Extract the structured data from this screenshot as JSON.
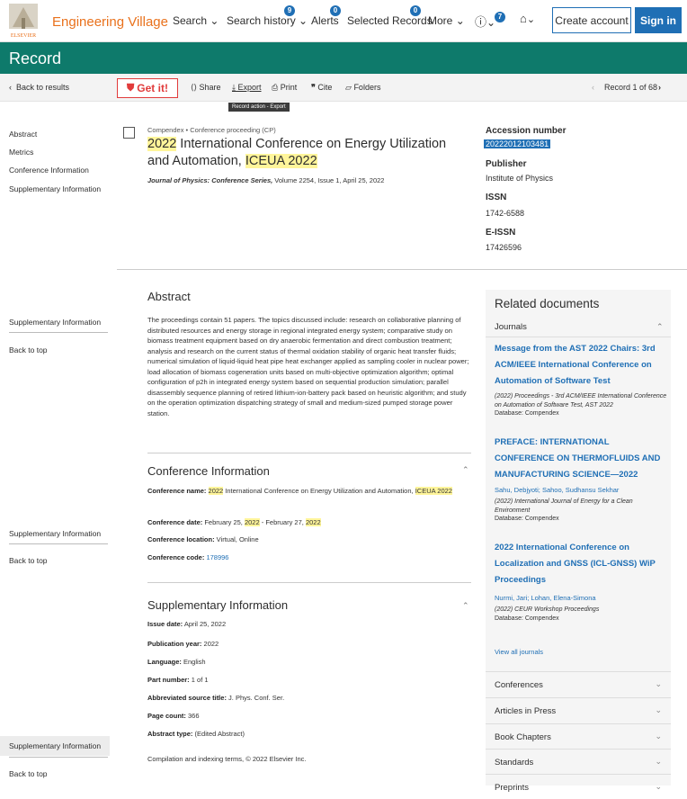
{
  "header": {
    "brand": "Engineering Village",
    "nav": [
      {
        "label": "Search",
        "chevron": true
      },
      {
        "label": "Search history",
        "chevron": true,
        "badge": "9"
      },
      {
        "label": "Alerts",
        "badge": "0"
      },
      {
        "label": "Selected Records",
        "badge": "0"
      },
      {
        "label": "More",
        "chevron": true
      }
    ],
    "help_badge": "7",
    "create_account": "Create account",
    "sign_in": "Sign in"
  },
  "page_title": "Record",
  "action_bar": {
    "back": "Back to results",
    "getit": "Get it!",
    "share": "Share",
    "export": "Export",
    "print": "Print",
    "cite": "Cite",
    "folders": "Folders",
    "record_nav": "Record 1 of 68",
    "tooltip": "Record action - Export"
  },
  "sidebar": {
    "items": [
      "Abstract",
      "Metrics",
      "Conference Information",
      "Supplementary Information"
    ],
    "sticky_label": "Supplementary Information",
    "back_to_top": "Back to top"
  },
  "record": {
    "meta": "Compendex • Conference proceeding (CP)",
    "title_part1": "2022",
    "title_part2": " International Conference on Energy Utilization and Automation, ",
    "title_part3": "ICEUA 2022",
    "journal_name": "Journal of Physics: Conference Series,",
    "journal_rest": " Volume 2254, Issue 1, April 25, 2022"
  },
  "details": {
    "accession_label": "Accession number",
    "accession_value": "20222012103481",
    "publisher_label": "Publisher",
    "publisher_value": "Institute of Physics",
    "issn_label": "ISSN",
    "issn_value": "1742-6588",
    "eissn_label": "E-ISSN",
    "eissn_value": "17426596"
  },
  "abstract": {
    "heading": "Abstract",
    "text": "The proceedings contain 51 papers. The topics discussed include: research on collaborative planning of distributed resources and energy storage in regional integrated energy system; comparative study on biomass treatment equipment based on dry anaerobic fermentation and direct combustion treatment; analysis and research on the current status of thermal oxidation stability of organic heat transfer fluids; numerical simulation of liquid-liquid heat pipe heat exchanger applied as sampling cooler in nuclear power; load allocation of biomass cogeneration units based on multi-objective optimization algorithm; optimal configuration of p2h in integrated energy system based on sequential production simulation; parallel disassembly sequence planning of retired lithium-ion-battery pack based on heuristic algorithm; and study on the operation optimization dispatching strategy of small and medium-sized pumped storage power station."
  },
  "conference": {
    "heading": "Conference Information",
    "name_label": "Conference name:",
    "name_hl1": "2022",
    "name_mid": " International Conference on Energy Utilization and Automation, ",
    "name_hl2": "ICEUA 2022",
    "date_label": "Conference date:",
    "date_a": " February 25, ",
    "date_hl1": "2022",
    "date_b": " - February 27, ",
    "date_hl2": "2022",
    "location_label": "Conference location:",
    "location_value": " Virtual, Online",
    "code_label": "Conference code:",
    "code_value": "178996"
  },
  "supplementary": {
    "heading": "Supplementary Information",
    "rows": [
      {
        "label": "Issue date:",
        "value": " April 25, 2022"
      },
      {
        "label": "Publication year:",
        "value": " 2022"
      },
      {
        "label": "Language:",
        "value": " English"
      },
      {
        "label": "Part number:",
        "value": " 1 of 1"
      },
      {
        "label": "Abbreviated source title:",
        "value": " J. Phys. Conf. Ser."
      },
      {
        "label": "Page count:",
        "value": " 366"
      },
      {
        "label": "Abstract type:",
        "value": " (Edited Abstract)"
      }
    ],
    "copyright": "Compilation and indexing terms, © 2022 Elsevier Inc."
  },
  "related": {
    "heading": "Related documents",
    "journals_label": "Journals",
    "docs": [
      {
        "title": "Message from the AST 2022 Chairs: 3rd ACM/IEEE International Conference on Automation of Software Test",
        "authors": "",
        "info": "(2022) Proceedings - 3rd ACM/IEEE International Conference on Automation of Software Test, AST 2022",
        "db": "Database: Compendex"
      },
      {
        "title": "PREFACE: INTERNATIONAL CONFERENCE ON THERMOFLUIDS AND MANUFACTURING SCIENCE—2022",
        "authors": "Sahu, Debjyoti; Sahoo, Sudhansu Sekhar",
        "info": "(2022) International Journal of Energy for a Clean Environment",
        "db": "Database: Compendex"
      },
      {
        "title": "2022 International Conference on Localization and GNSS (ICL-GNSS) WiP Proceedings",
        "authors": "Nurmi, Jari; Lohan, Elena-Simona",
        "info": "(2022) CEUR Workshop Proceedings",
        "db": "Database: Compendex"
      }
    ],
    "view_all": "View all journals",
    "categories": [
      "Conferences",
      "Articles in Press",
      "Book Chapters",
      "Standards",
      "Preprints"
    ]
  },
  "colors": {
    "accent": "#0e7a6b",
    "link": "#1f6fb5",
    "brand": "#e9711c",
    "highlight": "#fff59a"
  }
}
